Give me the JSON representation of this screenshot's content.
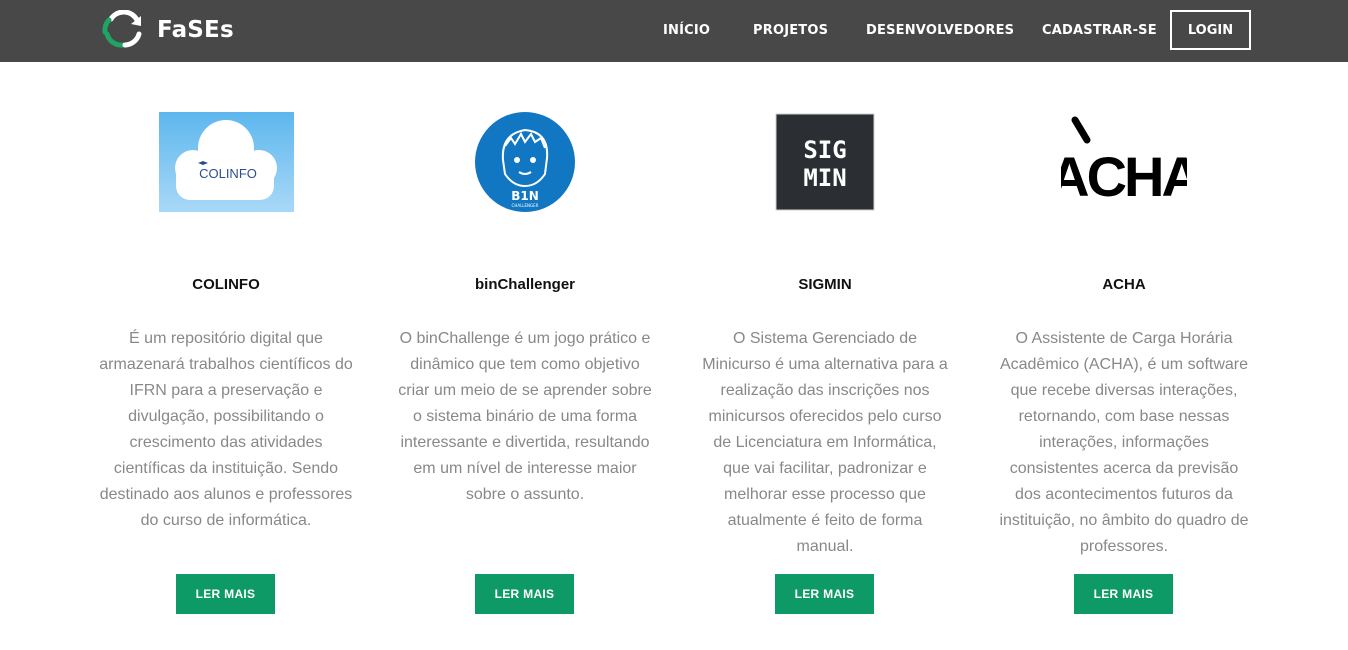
{
  "brand": {
    "name": "FaSEs"
  },
  "nav": {
    "items": [
      "INÍCIO",
      "PROJETOS",
      "DESENVOLVEDORES",
      "CADASTRAR-SE"
    ],
    "login_label": "LOGIN"
  },
  "colors": {
    "navbar": "#484848",
    "accent": "#0e9a66"
  },
  "projects": [
    {
      "logo_text": "COLINFO",
      "title": "COLINFO",
      "description": "É um repositório digital que armazenará trabalhos científicos do IFRN para a preservação e divulgação, possibilitando o crescimento das atividades científicas da instituição. Sendo destinado aos alunos e professores do curso de informática.",
      "button_label": "LER MAIS"
    },
    {
      "logo_text": "B1N",
      "logo_subtext": "CHALLENGER",
      "title": "binChallenger",
      "description": "O binChallenge é um jogo prático e dinâmico que tem como objetivo criar um meio de se aprender sobre o sistema binário de uma forma interessante e divertida, resultando em um nível de interesse maior sobre o assunto.",
      "button_label": "LER MAIS"
    },
    {
      "logo_text": "SIG",
      "logo_text2": "MIN",
      "title": "SIGMIN",
      "description": "O Sistema Gerenciado de Minicurso é uma alternativa para a realização das inscrições nos minicursos oferecidos pelo curso de Licenciatura em Informática, que vai facilitar, padronizar e melhorar esse processo que atualmente é feito de forma manual.",
      "button_label": "LER MAIS"
    },
    {
      "logo_text": "ACHA",
      "title": "ACHA",
      "description": "O Assistente de Carga Horária Acadêmico (ACHA), é um software que recebe diversas interações, retornando, com base nessas interações, informações consistentes acerca da previsão dos acontecimentos futuros da instituição, no âmbito do quadro de professores.",
      "button_label": "LER MAIS"
    }
  ]
}
